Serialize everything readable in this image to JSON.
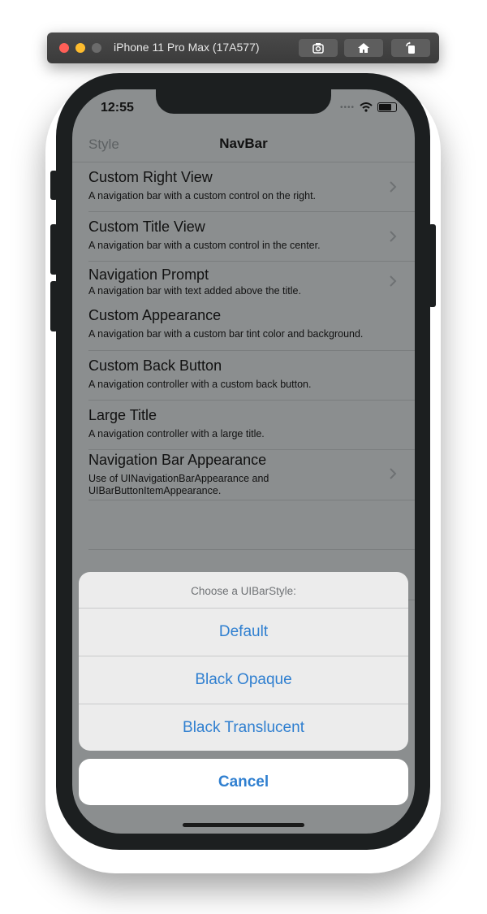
{
  "simulator": {
    "title": "iPhone 11 Pro Max (17A577)",
    "buttons": [
      "screenshot-icon",
      "home-icon",
      "rotate-icon"
    ]
  },
  "status_bar": {
    "time": "12:55",
    "icons": [
      "signal-dots-icon",
      "wifi-icon",
      "battery-icon"
    ]
  },
  "nav_bar": {
    "left_button": "Style",
    "title": "NavBar"
  },
  "rows": [
    {
      "title": "Custom Right View",
      "subtitle": "A navigation bar with a custom control on the right.",
      "chevron": true
    },
    {
      "title": "Custom Title View",
      "subtitle": "A navigation bar with a custom control in the center.",
      "chevron": true
    },
    {
      "title": "Navigation Prompt",
      "subtitle": "A navigation bar with text added above the title.",
      "chevron": true
    },
    {
      "title": "Custom Appearance",
      "subtitle": "A navigation bar with a custom bar tint color and background.",
      "chevron": false
    },
    {
      "title": "Custom Back Button",
      "subtitle": "A navigation controller with a custom back button.",
      "chevron": false
    },
    {
      "title": "Large Title",
      "subtitle": "A navigation controller with a large title.",
      "chevron": false
    },
    {
      "title": "Navigation Bar Appearance",
      "subtitle": "Use of UINavigationBarAppearance and UIBarButtonItemAppearance.",
      "chevron": true
    }
  ],
  "action_sheet": {
    "title": "Choose a UIBarStyle:",
    "options": [
      "Default",
      "Black Opaque",
      "Black Translucent"
    ],
    "cancel": "Cancel"
  },
  "colors": {
    "accent": "#2f7fd0",
    "dim_background": "#8b8e8f",
    "sheet_background": "#ececec"
  }
}
